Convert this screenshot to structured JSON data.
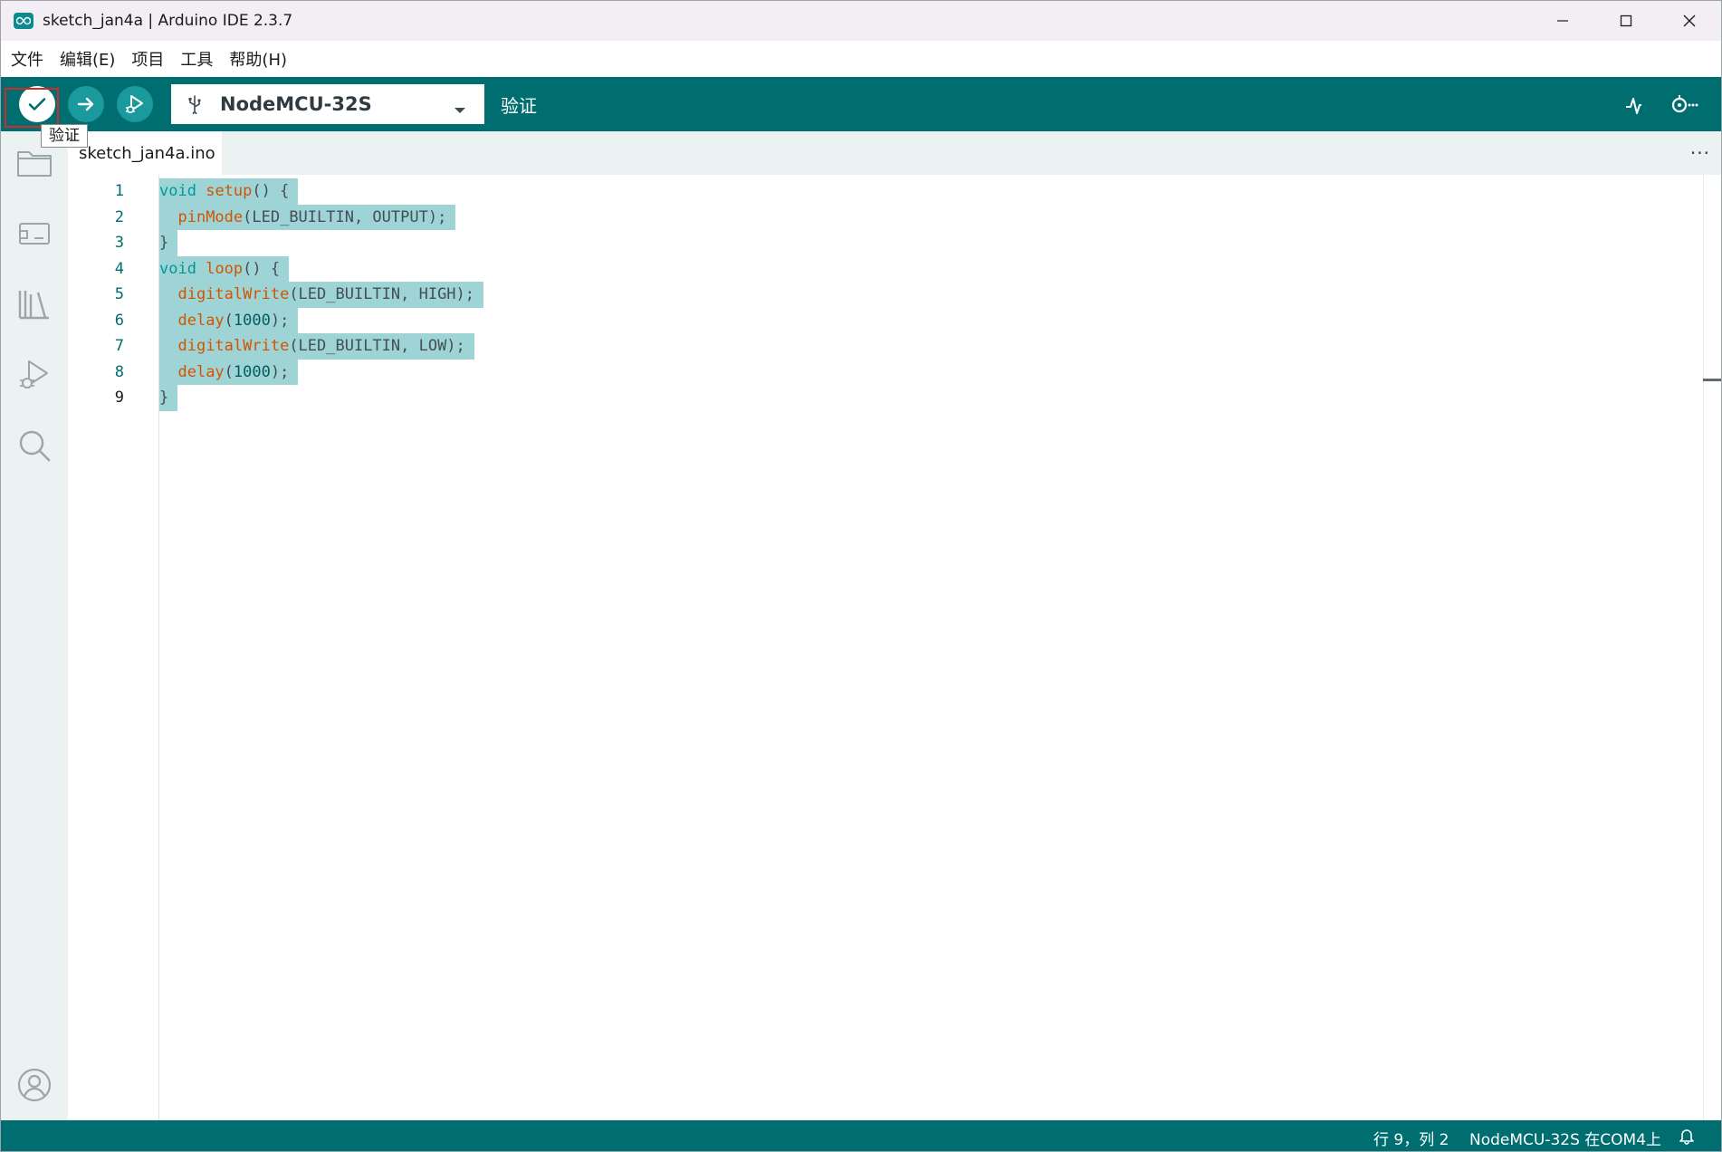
{
  "window": {
    "title": "sketch_jan4a | Arduino IDE 2.3.7",
    "controls": [
      "minimize",
      "maximize",
      "close"
    ]
  },
  "menu": {
    "items": [
      "文件",
      "编辑(E)",
      "项目",
      "工具",
      "帮助(H)"
    ]
  },
  "toolbar": {
    "verify_icon": "check-icon",
    "upload_icon": "arrow-right-icon",
    "debug_icon": "debug-play-icon",
    "board": "NodeMCU-32S",
    "status_text": "验证",
    "tooltip": "验证",
    "plotter_icon": "serial-plotter-icon",
    "monitor_icon": "serial-monitor-icon"
  },
  "sidebar": {
    "items": [
      "folder-icon",
      "board-manager-icon",
      "library-icon",
      "debug-icon",
      "search-icon"
    ],
    "bottom": "account-icon"
  },
  "tabs": {
    "active": "sketch_jan4a.ino",
    "more": "···"
  },
  "editor": {
    "line_numbers": [
      "1",
      "2",
      "3",
      "4",
      "5",
      "6",
      "7",
      "8",
      "9"
    ],
    "current_line": 9,
    "lines": [
      [
        [
          "kw",
          "void"
        ],
        [
          "pl",
          " "
        ],
        [
          "fn",
          "setup"
        ],
        [
          "pl",
          "() {"
        ]
      ],
      [
        [
          "pl",
          "  "
        ],
        [
          "fn",
          "pinMode"
        ],
        [
          "pl",
          "(LED_BUILTIN, OUTPUT);"
        ]
      ],
      [
        [
          "pl",
          "}"
        ]
      ],
      [
        [
          "kw",
          "void"
        ],
        [
          "pl",
          " "
        ],
        [
          "fn",
          "loop"
        ],
        [
          "pl",
          "() {"
        ]
      ],
      [
        [
          "pl",
          "  "
        ],
        [
          "fn",
          "digitalWrite"
        ],
        [
          "pl",
          "(LED_BUILTIN, HIGH);"
        ]
      ],
      [
        [
          "pl",
          "  "
        ],
        [
          "fn",
          "delay"
        ],
        [
          "pl",
          "("
        ],
        [
          "num",
          "1000"
        ],
        [
          "pl",
          ");"
        ]
      ],
      [
        [
          "pl",
          "  "
        ],
        [
          "fn",
          "digitalWrite"
        ],
        [
          "pl",
          "(LED_BUILTIN, LOW);"
        ]
      ],
      [
        [
          "pl",
          "  "
        ],
        [
          "fn",
          "delay"
        ],
        [
          "pl",
          "("
        ],
        [
          "num",
          "1000"
        ],
        [
          "pl",
          ");"
        ]
      ],
      [
        [
          "pl",
          "}"
        ]
      ]
    ]
  },
  "status": {
    "position": "行 9，列 2",
    "board_port": "NodeMCU-32S 在COM4上",
    "bell_icon": "bell-icon"
  },
  "colors": {
    "accent": "#006d70",
    "selection": "#9fd4d6",
    "keyword": "#00979c",
    "function": "#d35400",
    "highlight_box": "#d02a2a"
  }
}
